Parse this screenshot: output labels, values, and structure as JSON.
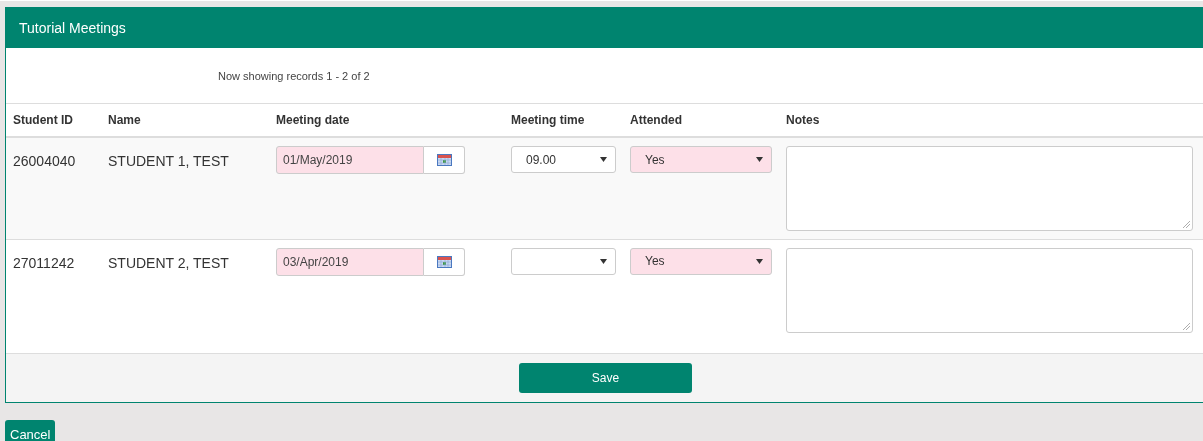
{
  "panel": {
    "title": "Tutorial Meetings",
    "records_info": "Now showing records 1 - 2 of 2"
  },
  "table": {
    "columns": [
      "Student ID",
      "Name",
      "Meeting date",
      "Meeting time",
      "Attended",
      "Notes"
    ],
    "rows": [
      {
        "student_id": "26004040",
        "name": "STUDENT 1, TEST",
        "meeting_date": {
          "value": "01/May/2019",
          "required": true
        },
        "meeting_time": {
          "value": "09.00",
          "required": false
        },
        "attended": {
          "value": "Yes",
          "required": true
        }
      },
      {
        "student_id": "27011242",
        "name": "STUDENT 2, TEST",
        "meeting_date": {
          "value": "03/Apr/2019",
          "required": true
        },
        "meeting_time": {
          "required": false
        },
        "attended": {
          "value": "Yes",
          "required": true
        }
      }
    ]
  },
  "buttons": {
    "save": "Save",
    "cancel": "Cancel"
  }
}
